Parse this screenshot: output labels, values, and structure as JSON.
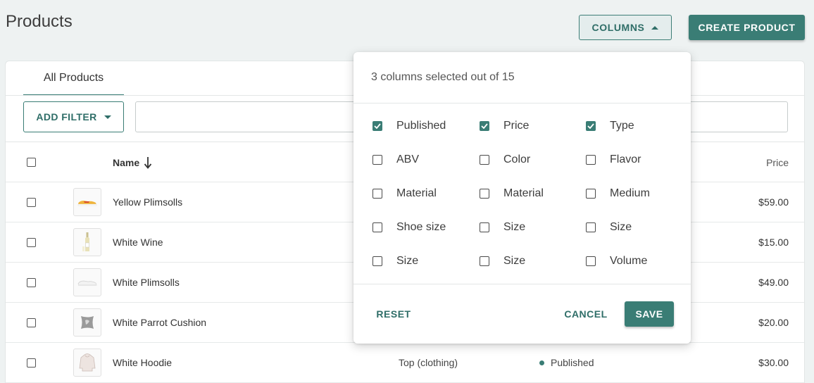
{
  "header": {
    "title": "Products",
    "columns_label": "COLUMNS",
    "create_label": "CREATE PRODUCT"
  },
  "tabs": {
    "all_products": "All Products"
  },
  "filter": {
    "add_filter_label": "ADD FILTER",
    "search_value": ""
  },
  "table": {
    "columns": {
      "name": "Name",
      "price": "Price"
    },
    "rows": [
      {
        "name": "Yellow Plimsolls",
        "type": "",
        "status": "",
        "price": "$59.00"
      },
      {
        "name": "White Wine",
        "type": "",
        "status": "",
        "price": "$15.00"
      },
      {
        "name": "White Plimsolls",
        "type": "",
        "status": "",
        "price": "$49.00"
      },
      {
        "name": "White Parrot Cushion",
        "type": "",
        "status": "",
        "price": "$20.00"
      },
      {
        "name": "White Hoodie",
        "type": "Top (clothing)",
        "status": "Published",
        "price": "$30.00"
      }
    ]
  },
  "column_picker": {
    "summary": "3 columns selected out of 15",
    "options": [
      {
        "label": "Published",
        "checked": true
      },
      {
        "label": "Price",
        "checked": true
      },
      {
        "label": "Type",
        "checked": true
      },
      {
        "label": "ABV",
        "checked": false
      },
      {
        "label": "Color",
        "checked": false
      },
      {
        "label": "Flavor",
        "checked": false
      },
      {
        "label": "Material",
        "checked": false
      },
      {
        "label": "Material",
        "checked": false
      },
      {
        "label": "Medium",
        "checked": false
      },
      {
        "label": "Shoe size",
        "checked": false
      },
      {
        "label": "Size",
        "checked": false
      },
      {
        "label": "Size",
        "checked": false
      },
      {
        "label": "Size",
        "checked": false
      },
      {
        "label": "Size",
        "checked": false
      },
      {
        "label": "Volume",
        "checked": false
      }
    ],
    "reset_label": "RESET",
    "cancel_label": "CANCEL",
    "save_label": "SAVE"
  },
  "colors": {
    "accent": "#3a7d75",
    "background": "#eef2f2"
  }
}
